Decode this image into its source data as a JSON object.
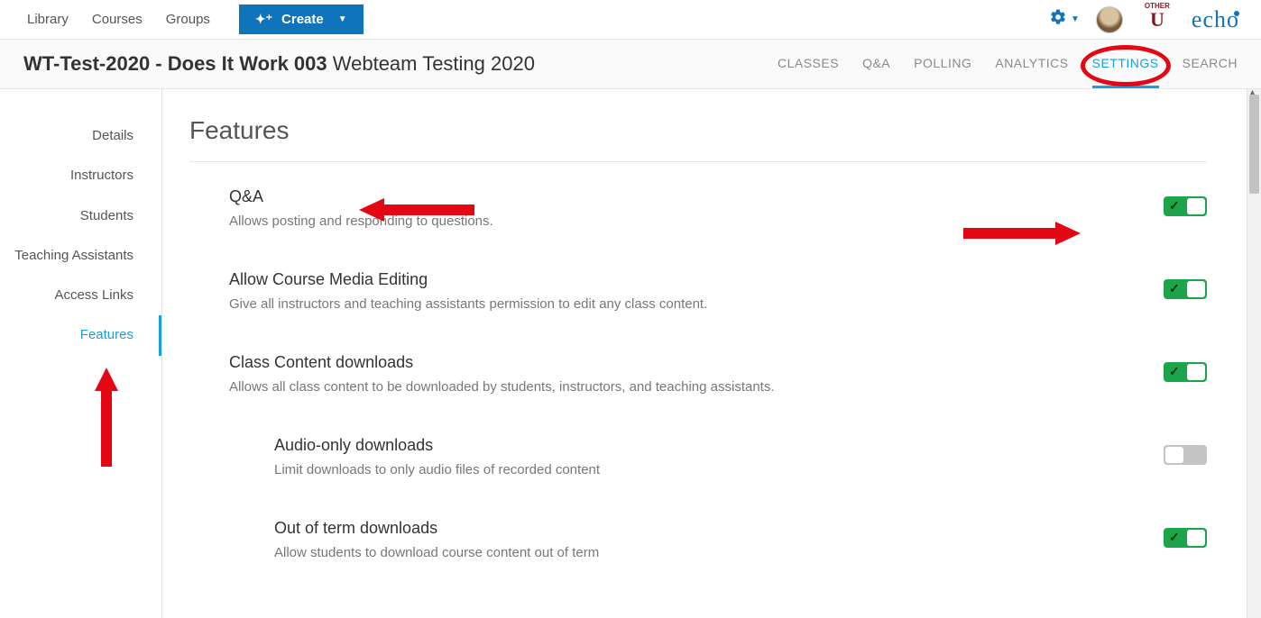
{
  "topnav": {
    "links": [
      "Library",
      "Courses",
      "Groups"
    ],
    "create_label": "Create",
    "brand": "echo"
  },
  "course": {
    "title_bold": "WT-Test-2020 - Does It Work 003",
    "title_rest": " Webteam Testing 2020",
    "tabs": [
      "CLASSES",
      "Q&A",
      "POLLING",
      "ANALYTICS",
      "SETTINGS",
      "SEARCH"
    ],
    "active_tab": "SETTINGS"
  },
  "sidebar": {
    "items": [
      "Details",
      "Instructors",
      "Students",
      "Teaching Assistants",
      "Access Links",
      "Features"
    ],
    "active": "Features"
  },
  "page": {
    "heading": "Features"
  },
  "features": [
    {
      "title": "Q&A",
      "desc": "Allows posting and responding to questions.",
      "on": true,
      "sub": false
    },
    {
      "title": "Allow Course Media Editing",
      "desc": "Give all instructors and teaching assistants permission to edit any class content.",
      "on": true,
      "sub": false
    },
    {
      "title": "Class Content downloads",
      "desc": "Allows all class content to be downloaded by students, instructors, and teaching assistants.",
      "on": true,
      "sub": false
    },
    {
      "title": "Audio-only downloads",
      "desc": "Limit downloads to only audio files of recorded content",
      "on": false,
      "sub": true
    },
    {
      "title": "Out of term downloads",
      "desc": "Allow students to download course content out of term",
      "on": true,
      "sub": true
    }
  ],
  "org_badge": {
    "top": "OTHER",
    "letter": "U"
  }
}
